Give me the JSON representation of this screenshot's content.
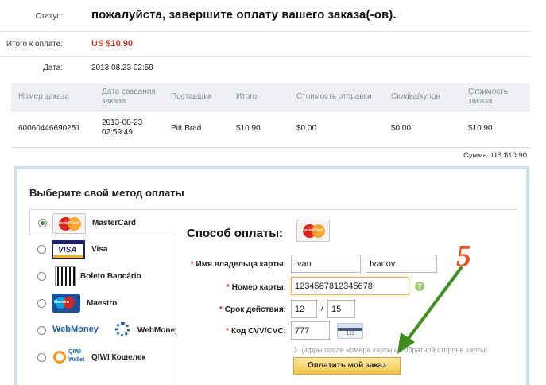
{
  "summary": {
    "status_label": "Статус:",
    "status_value": "пожалуйста, завершите оплату вашего заказа(-ов).",
    "total_label": "Итого к оплате:",
    "total_value": "US $10.90",
    "date_label": "Дата:",
    "date_value": "2013.08.23 02:59"
  },
  "orders": {
    "headers": [
      "Номер заказа",
      "Дата создания заказа",
      "Поставщик",
      "Итого",
      "Стоимость отправки",
      "Скидка/купон",
      "Стоимость заказа"
    ],
    "rows": [
      [
        "60060446690251",
        "2013-08-23 02:59:49",
        "Pitt Brad",
        "$10.90",
        "$0.00",
        "$0.00",
        "$10.90"
      ]
    ],
    "sum": "Сумма: US $10.90"
  },
  "payment": {
    "title": "Выберите свой метод оплаты",
    "methods": [
      {
        "label": "MasterCard",
        "icon": "mastercard-logo",
        "selected": true
      },
      {
        "label": "Visa",
        "icon": "visa-logo",
        "selected": false
      },
      {
        "label": "Boleto Bancário",
        "icon": "boleto-logo",
        "selected": false
      },
      {
        "label": "Maestro",
        "icon": "maestro-logo",
        "selected": false
      },
      {
        "label": "WebMoney",
        "icon": "webmoney-logo",
        "selected": false
      },
      {
        "label": "QIWI Кошелек",
        "icon": "qiwi-logo",
        "selected": false
      }
    ],
    "logo_texts": {
      "mastercard": "MasterCard",
      "visa": "VISA",
      "maestro": "Maestro",
      "webmoney": "WebMoney",
      "qiwi_top": "QIWI",
      "qiwi_bottom": "Wallet"
    }
  },
  "form": {
    "title": "Способ оплаты:",
    "holder_label": "Имя владельца карты:",
    "first_name": "Ivan",
    "last_name": "Ivanov",
    "card_label": "Номер карты:",
    "card_number": "1234567812345678",
    "expiry_label": "Срок действия:",
    "expiry_month": "12",
    "expiry_year": "15",
    "expiry_separator": "/",
    "cvv_label": "Код CVV/CVC:",
    "cvv_value": "777",
    "cvv_icon_number": "123",
    "cvv_hint": "3 цифры после номера карты на обратной стороне карты.",
    "help_symbol": "?",
    "submit_label": "Оплатить мой заказ"
  },
  "annotation": {
    "step_number": "5",
    "arrow_color": "#3e8e1f",
    "number_color": "#e8531f"
  },
  "colors": {
    "accent_red": "#c0392b",
    "table_header_bg": "#eef0f3",
    "panel_border": "#cfdff0",
    "button_yellow": "#f5c64a"
  }
}
